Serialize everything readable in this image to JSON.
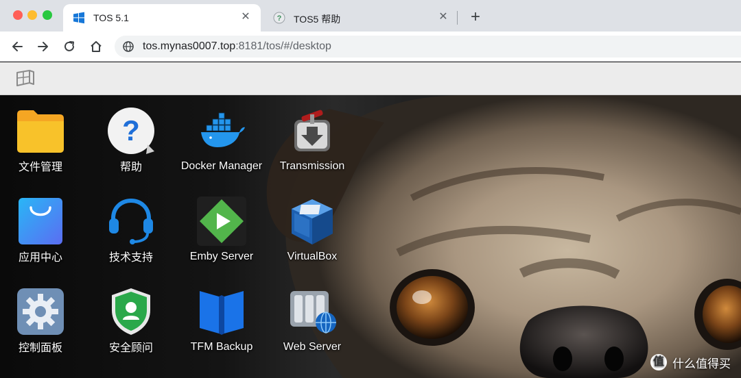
{
  "browser": {
    "tabs": [
      {
        "title": "TOS 5.1",
        "favicon": "tos-window-icon",
        "active": true
      },
      {
        "title": "TOS5 帮助",
        "favicon": "help-favicon",
        "active": false
      }
    ],
    "close_glyph": "✕",
    "new_tab_glyph": "+",
    "url_host": "tos.mynas0007.top",
    "url_rest": ":8181/tos/#/desktop"
  },
  "tos_bar": {
    "logo_icon": "tos-desktop-logo-icon"
  },
  "desktop": {
    "apps": [
      {
        "label": "文件管理",
        "icon": "folder-icon"
      },
      {
        "label": "帮助",
        "icon": "help-icon"
      },
      {
        "label": "Docker Manager",
        "icon": "docker-icon"
      },
      {
        "label": "Transmission",
        "icon": "transmission-icon"
      },
      {
        "label": "应用中心",
        "icon": "app-center-bag-icon"
      },
      {
        "label": "技术支持",
        "icon": "headset-icon"
      },
      {
        "label": "Emby Server",
        "icon": "emby-play-icon"
      },
      {
        "label": "VirtualBox",
        "icon": "virtualbox-cube-icon"
      },
      {
        "label": "控制面板",
        "icon": "gear-icon"
      },
      {
        "label": "安全顾问",
        "icon": "security-shield-icon"
      },
      {
        "label": "TFM Backup",
        "icon": "tfm-backup-icon"
      },
      {
        "label": "Web Server",
        "icon": "web-server-icon"
      }
    ]
  },
  "watermark": {
    "text": "什么值得买",
    "badge": "值"
  },
  "colors": {
    "tab_bar": "#dee1e6",
    "tos_bar": "#ececec",
    "folder": "#f8c22a",
    "app_center": "#3d8cf5",
    "emby": "#52b54b"
  }
}
